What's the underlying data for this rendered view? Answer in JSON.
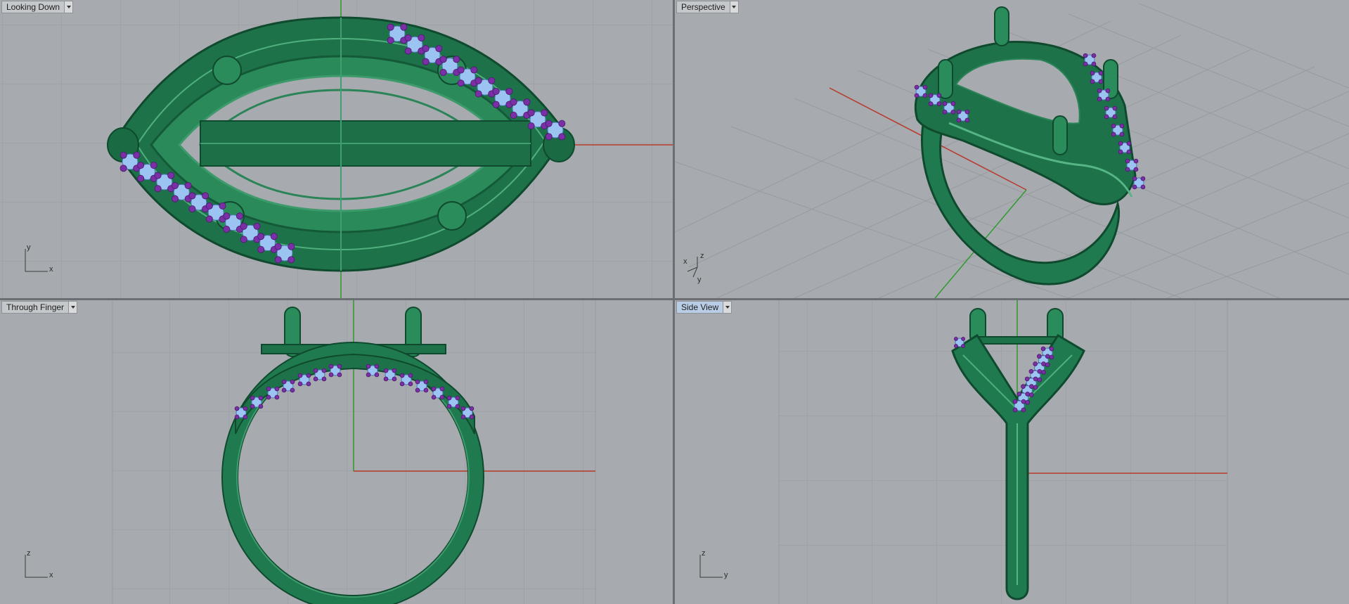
{
  "viewports": [
    {
      "label": "Looking Down",
      "axes": [
        "y",
        "x"
      ],
      "active": false
    },
    {
      "label": "Perspective",
      "axes": [
        "z",
        "x",
        "y"
      ],
      "active": false
    },
    {
      "label": "Through Finger",
      "axes": [
        "z",
        "x"
      ],
      "active": false
    },
    {
      "label": "Side View",
      "axes": [
        "z",
        "y"
      ],
      "active": true
    }
  ],
  "icons": {
    "dropdown": "chevron-down-icon"
  },
  "colors": {
    "viewport_bg": "#a7abaf",
    "grid": "#969a9e",
    "ring_green": "#1f7a50",
    "ring_highlight": "#43a873",
    "gem_blue": "#9cc4f2",
    "prong_purple": "#7a2fa6",
    "x_axis": "#b83a2c",
    "y_axis": "#2f9a2f"
  }
}
